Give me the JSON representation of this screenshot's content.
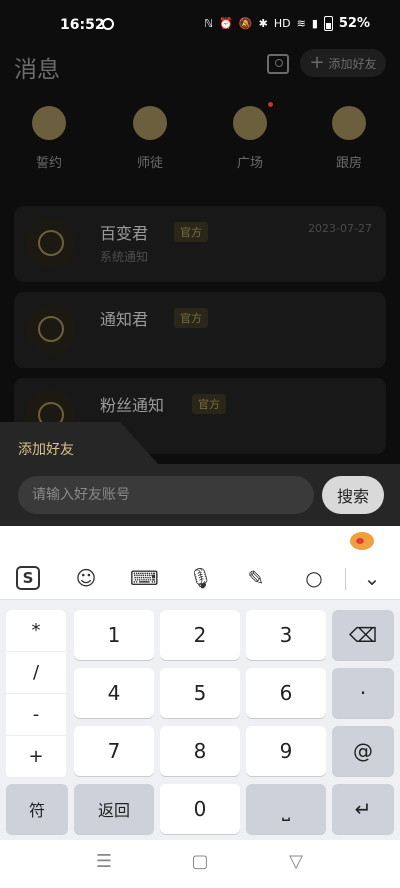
{
  "status": {
    "time": "16:52",
    "battery": "52%",
    "icons": [
      "nfc-icon",
      "alarm-icon",
      "mute-icon",
      "bluetooth-icon",
      "hd-icon",
      "wifi-icon",
      "signal-icon",
      "battery-icon"
    ]
  },
  "header": {
    "title": "消息",
    "add_friend_label": "添加好友"
  },
  "quick_actions": [
    {
      "label": "誓约",
      "icon": "lock-icon"
    },
    {
      "label": "师徒",
      "icon": "hand-icon"
    },
    {
      "label": "广场",
      "icon": "planet-icon",
      "has_dot": true
    },
    {
      "label": "跟房",
      "icon": "person-icon"
    }
  ],
  "messages": [
    {
      "name": "百变君",
      "badge": "官方",
      "subtitle": "系统通知",
      "date": "2023-07-27"
    },
    {
      "name": "通知君",
      "badge": "官方",
      "subtitle": "",
      "date": ""
    },
    {
      "name": "粉丝通知",
      "badge": "官方",
      "subtitle": "",
      "date": ""
    }
  ],
  "add_panel": {
    "title": "添加好友",
    "placeholder": "请输入好友账号",
    "search_label": "搜索"
  },
  "keyboard": {
    "symbols": [
      "*",
      "/",
      "-",
      "+"
    ],
    "digits": [
      "1",
      "2",
      "3",
      "4",
      "5",
      "6",
      "7",
      "8",
      "9",
      "0"
    ],
    "period": "·",
    "at": "@",
    "symbol_key": "符",
    "back_key": "返回"
  },
  "colors": {
    "accent": "#d8c089",
    "bg": "#0d0d0d",
    "card": "#181818"
  }
}
